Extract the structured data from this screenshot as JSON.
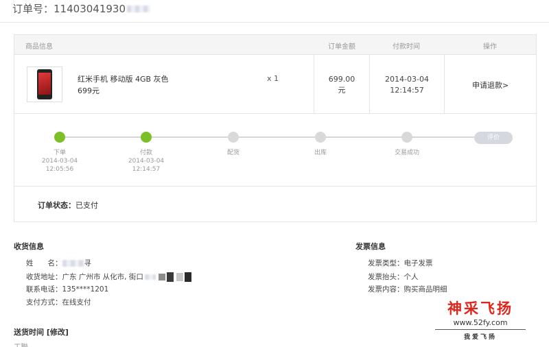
{
  "order": {
    "label": "订单号：",
    "number": "11403041930"
  },
  "table": {
    "headers": {
      "product": "商品信息",
      "amount": "订单金额",
      "pay_time": "付款时间",
      "action": "操作"
    },
    "item": {
      "name": "红米手机 移动版 4GB 灰色",
      "price": "699元",
      "qty": "x 1",
      "amount_value": "699.00",
      "amount_unit": "元",
      "pay_date": "2014-03-04",
      "pay_clock": "12:14:57",
      "refund_label": "申请退款>"
    }
  },
  "progress": {
    "completed_steps": 2,
    "steps": [
      {
        "label": "下单",
        "date": "2014-03-04",
        "time": "12:05:56"
      },
      {
        "label": "付款",
        "date": "2014-03-04",
        "time": "12:14:57"
      },
      {
        "label": "配货"
      },
      {
        "label": "出库"
      },
      {
        "label": "交易成功"
      }
    ],
    "review_label": "评价",
    "done_color": "#7dbf28",
    "pending_color": "#d9d9d9"
  },
  "status": {
    "label": "订单状态：",
    "value": "已支付"
  },
  "shipping": {
    "title": "收货信息",
    "name_label": "姓　　名：",
    "name_value": "寻",
    "address_label": "收货地址：",
    "address_value": "广东 广州市 从化市, 街口",
    "phone_label": "联系电话：",
    "phone_value": "135****1201",
    "payment_label": "支付方式：",
    "payment_value": "在线支付"
  },
  "invoice": {
    "title": "发票信息",
    "type_label": "发票类型：",
    "type_value": "电子发票",
    "header_label": "发票抬头：",
    "header_value": "个人",
    "content_label": "发票内容：",
    "content_value": "购买商品明细"
  },
  "delivery": {
    "title": "送货时间 [修改]",
    "value": "工聯"
  },
  "watermark": {
    "title": "神采飞扬",
    "url": "www.52fy.com",
    "sub": "我爱飞扬"
  }
}
